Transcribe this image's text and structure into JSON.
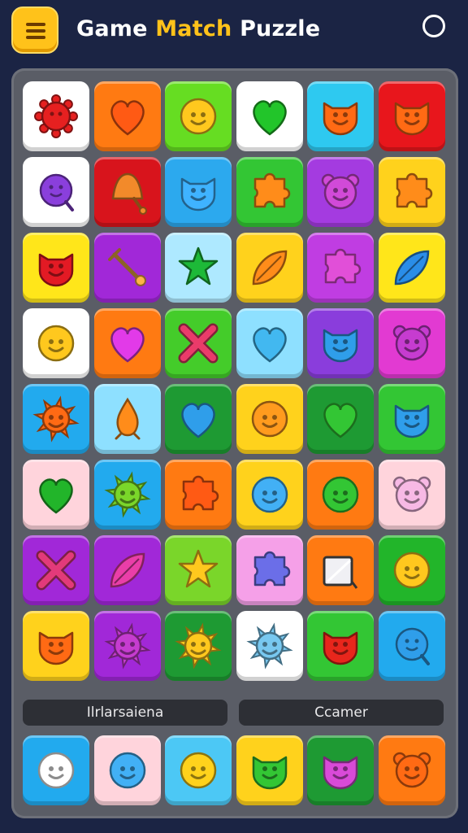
{
  "header": {
    "title_prefix": "Game ",
    "title_accent": "Match",
    "title_suffix": " Puzzle"
  },
  "labels": {
    "left": "Ilrlarsaiena",
    "right": "Ccamer"
  },
  "colors": {
    "background": "#1b2444",
    "board": "#5a5d66",
    "accent": "#ffc21a"
  },
  "grid": [
    [
      {
        "bg": "#ffffff",
        "icon": "spiky-blob-icon",
        "color": "#e62020"
      },
      {
        "bg": "#ff7a12",
        "icon": "heart-icon",
        "color": "#ff5a14"
      },
      {
        "bg": "#66dd22",
        "icon": "smiley-face-icon",
        "color": "#ffc81e"
      },
      {
        "bg": "#ffffff",
        "icon": "heart-icon",
        "color": "#22c52a"
      },
      {
        "bg": "#2ec9f0",
        "icon": "cat-face-icon",
        "color": "#ff6a14"
      },
      {
        "bg": "#e8161c",
        "icon": "cat-face-icon",
        "color": "#ff6a14"
      }
    ],
    [
      {
        "bg": "#ffffff",
        "icon": "bubble-face-icon",
        "color": "#8a3fdc"
      },
      {
        "bg": "#d8141c",
        "icon": "bell-icon",
        "color": "#f28a2a"
      },
      {
        "bg": "#2ca9ee",
        "icon": "cat-face-icon",
        "color": "#3fb3ff"
      },
      {
        "bg": "#33c634",
        "icon": "puzzle-piece-icon",
        "color": "#ff8c1a"
      },
      {
        "bg": "#a43be0",
        "icon": "bear-face-icon",
        "color": "#d14ad8"
      },
      {
        "bg": "#ffd21c",
        "icon": "puzzle-piece-icon",
        "color": "#ff8c1a"
      }
    ],
    [
      {
        "bg": "#ffe61a",
        "icon": "cat-face-icon",
        "color": "#e31a24"
      },
      {
        "bg": "#a128d8",
        "icon": "wand-icon",
        "color": "#ffb347"
      },
      {
        "bg": "#aee9ff",
        "icon": "star-icon",
        "color": "#1db938"
      },
      {
        "bg": "#ffd21c",
        "icon": "leaf-icon",
        "color": "#ff8c1a"
      },
      {
        "bg": "#c03de2",
        "icon": "puzzle-piece-icon",
        "color": "#e14fd8"
      },
      {
        "bg": "#ffe61a",
        "icon": "leaf-icon",
        "color": "#2a8de8"
      }
    ],
    [
      {
        "bg": "#ffffff",
        "icon": "smiley-face-icon",
        "color": "#ffc81e"
      },
      {
        "bg": "#ff7a12",
        "icon": "heart-icon",
        "color": "#e23ae8"
      },
      {
        "bg": "#44cc2a",
        "icon": "cross-icon",
        "color": "#ea3b6a"
      },
      {
        "bg": "#8ee0ff",
        "icon": "heart-icon",
        "color": "#42b8f0"
      },
      {
        "bg": "#8a3ddc",
        "icon": "cat-face-icon",
        "color": "#2f9eea"
      },
      {
        "bg": "#e23ad2",
        "icon": "bear-face-icon",
        "color": "#c63cd0"
      }
    ],
    [
      {
        "bg": "#22aaee",
        "icon": "sun-icon",
        "color": "#ff6a14"
      },
      {
        "bg": "#8ee0ff",
        "icon": "drop-icon",
        "color": "#ff8c1a"
      },
      {
        "bg": "#1e9a33",
        "icon": "heart-icon",
        "color": "#2f9eea"
      },
      {
        "bg": "#ffd21c",
        "icon": "smiley-face-icon",
        "color": "#ff9b1e"
      },
      {
        "bg": "#1e9a33",
        "icon": "heart-icon",
        "color": "#33c634"
      },
      {
        "bg": "#33c634",
        "icon": "cat-face-icon",
        "color": "#2f9eea"
      }
    ],
    [
      {
        "bg": "#ffd4dc",
        "icon": "heart-icon",
        "color": "#22b52a"
      },
      {
        "bg": "#22aaee",
        "icon": "sun-icon",
        "color": "#7ad62a"
      },
      {
        "bg": "#ff7a12",
        "icon": "puzzle-piece-icon",
        "color": "#ff5a14"
      },
      {
        "bg": "#ffd21c",
        "icon": "smiley-face-icon",
        "color": "#42b0f5"
      },
      {
        "bg": "#ff7a12",
        "icon": "smiley-face-icon",
        "color": "#33c634"
      },
      {
        "bg": "#ffd4dc",
        "icon": "bear-face-icon",
        "color": "#f7b9e5"
      }
    ],
    [
      {
        "bg": "#a128d8",
        "icon": "cross-icon",
        "color": "#e23a7a"
      },
      {
        "bg": "#a128d8",
        "icon": "leaf-icon",
        "color": "#ea3ea8"
      },
      {
        "bg": "#7ad62a",
        "icon": "star-icon",
        "color": "#ffc81e"
      },
      {
        "bg": "#f5a0e8",
        "icon": "puzzle-piece-icon",
        "color": "#6b6ee8"
      },
      {
        "bg": "#ff7a12",
        "icon": "card-icon",
        "color": "#f0f0f4"
      },
      {
        "bg": "#22b52a",
        "icon": "smiley-face-icon",
        "color": "#ffc81e"
      }
    ],
    [
      {
        "bg": "#ffd21c",
        "icon": "cat-face-icon",
        "color": "#ff6a14"
      },
      {
        "bg": "#a128d8",
        "icon": "sun-icon",
        "color": "#c63cd0"
      },
      {
        "bg": "#1e9a33",
        "icon": "sun-icon",
        "color": "#ffc81e"
      },
      {
        "bg": "#ffffff",
        "icon": "sun-icon",
        "color": "#78c8f0"
      },
      {
        "bg": "#33c634",
        "icon": "cat-face-icon",
        "color": "#e8261c"
      },
      {
        "bg": "#22aaee",
        "icon": "bubble-face-icon",
        "color": "#2f9eea"
      }
    ]
  ],
  "bottom_row": [
    {
      "bg": "#22aaee",
      "icon": "smiley-face-icon",
      "color": "#ffffff"
    },
    {
      "bg": "#ffd4dc",
      "icon": "smiley-face-icon",
      "color": "#42b0f5"
    },
    {
      "bg": "#4cc8f5",
      "icon": "smiley-face-icon",
      "color": "#ffd21c"
    },
    {
      "bg": "#ffd21c",
      "icon": "cat-face-icon",
      "color": "#33c634"
    },
    {
      "bg": "#1e9a33",
      "icon": "cat-face-icon",
      "color": "#d94ad8"
    },
    {
      "bg": "#ff7a12",
      "icon": "bear-face-icon",
      "color": "#ff6a14"
    }
  ]
}
